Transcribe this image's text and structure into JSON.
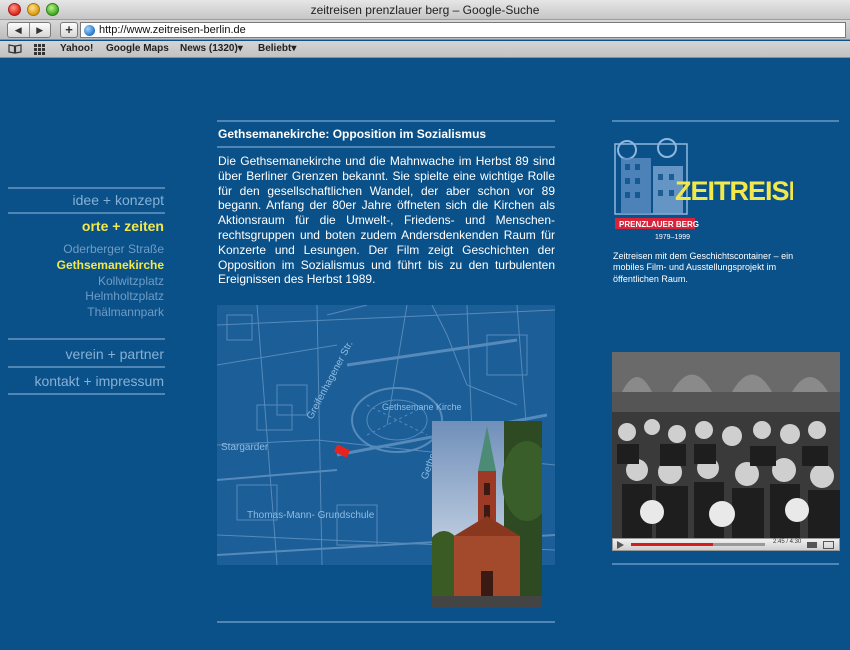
{
  "browser": {
    "window_title": "zeitreisen prenzlauer berg – Google-Suche",
    "url": "http://www.zeitreisen-berlin.de",
    "bookmarks": [
      "Yahoo!",
      "Google Maps",
      "News (1320)▾",
      "Beliebt▾"
    ]
  },
  "nav": {
    "main_top": [
      "idee + konzept",
      "orte + zeiten"
    ],
    "sub": [
      "Oderberger Straße",
      "Gethsemanekirche",
      "Kollwitzplatz",
      "Helmholtzplatz",
      "Thälmannpark"
    ],
    "main_bottom": [
      "verein + partner",
      "kontakt + impressum"
    ],
    "active_main": "orte + zeiten",
    "active_sub": "Gethsemanekirche"
  },
  "article": {
    "title": "Gethsemanekirche: Opposition im Sozialismus",
    "body": "Die Gethsemanekirche und die Mahnwache im Herbst 89 sind über Berliner Grenzen bekannt. Sie spielte eine wichtige Rolle für den gesellschaftlichen Wandel, der aber schon vor 89 begann. Anfang der 80er Jahre öffneten sich die Kirchen als Aktionsraum für die Umwelt-, Friedens- und Menschen-rechtsgruppen und boten zudem Andersdenkenden Raum für Konzerte und Lesungen. Der Film zeigt Geschichten der Opposition im Sozialismus und führt bis zu den turbulenten Ereignissen des Herbst 1989."
  },
  "map_labels": {
    "street_1": "Greifenhagener Str.",
    "church": "Gethsemane Kirche",
    "street_2": "Stargarder",
    "street_3": "Gethsemane",
    "school": "Thomas-Mann- Grundschule"
  },
  "logo": {
    "word": "ZEITREISEN",
    "badge": "PRENZLAUER BERG",
    "years": "1979–1999",
    "description": "Zeitreisen mit dem Geschichtscontainer – ein mobiles Film- und Ausstellungsprojekt im öffentlichen Raum."
  },
  "video": {
    "time": "2:45 / 4:30",
    "progress": 0.61
  },
  "colors": {
    "page_bg": "#0b5189",
    "accent_yellow": "#f2e84a",
    "nav_link": "#86b0d6",
    "rule": "#4f86b6"
  }
}
